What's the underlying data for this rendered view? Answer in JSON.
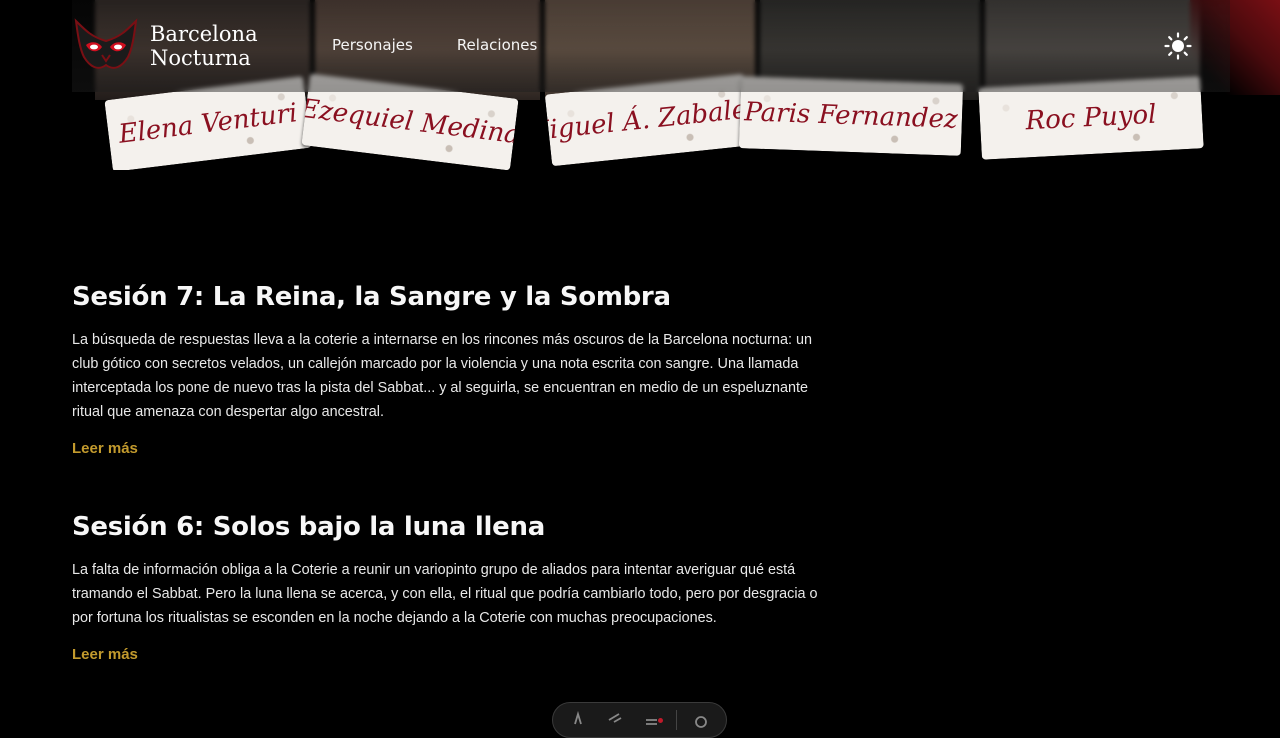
{
  "site": {
    "brand_line1": "Barcelona",
    "brand_line2": "Nocturna",
    "logo_icon": "mask-icon",
    "theme_icon": "sun-icon"
  },
  "nav": {
    "items": [
      {
        "label": "Personajes"
      },
      {
        "label": "Relaciones"
      }
    ]
  },
  "characters": [
    {
      "name": "Elena Venturi"
    },
    {
      "name": "Ezequiel Medina"
    },
    {
      "name": "Miguel Á. Zabaleta"
    },
    {
      "name": "Paris Fernandez"
    },
    {
      "name": "Roc Puyol"
    }
  ],
  "posts": [
    {
      "title": "Sesión 7: La Reina, la Sangre y la Sombra",
      "summary": "La búsqueda de respuestas lleva a la coterie a internarse en los rincones más oscuros de la Barcelona nocturna: un club gótico con secretos velados, un callejón marcado por la violencia y una nota escrita con sangre. Una llamada interceptada los pone de nuevo tras la pista del Sabbat... y al seguirla, se encuentran en medio de un espeluznante ritual que amenaza con despertar algo ancestral.",
      "read_more": "Leer más"
    },
    {
      "title": "Sesión 6: Solos bajo la luna llena",
      "summary": "La falta de información obliga a la Coterie a reunir un variopinto grupo de aliados para intentar averiguar qué está tramando el Sabbat. Pero la luna llena se acerca, y con ella, el ritual que podría cambiarlo todo, pero por desgracia o por fortuna los ritualistas se esconden en la noche dejando a la Coterie con muchas preocupaciones.",
      "read_more": "Leer más"
    }
  ],
  "colors": {
    "background": "#000000",
    "accent_link": "#c29a2d",
    "nameplate_text": "#8a1020"
  }
}
